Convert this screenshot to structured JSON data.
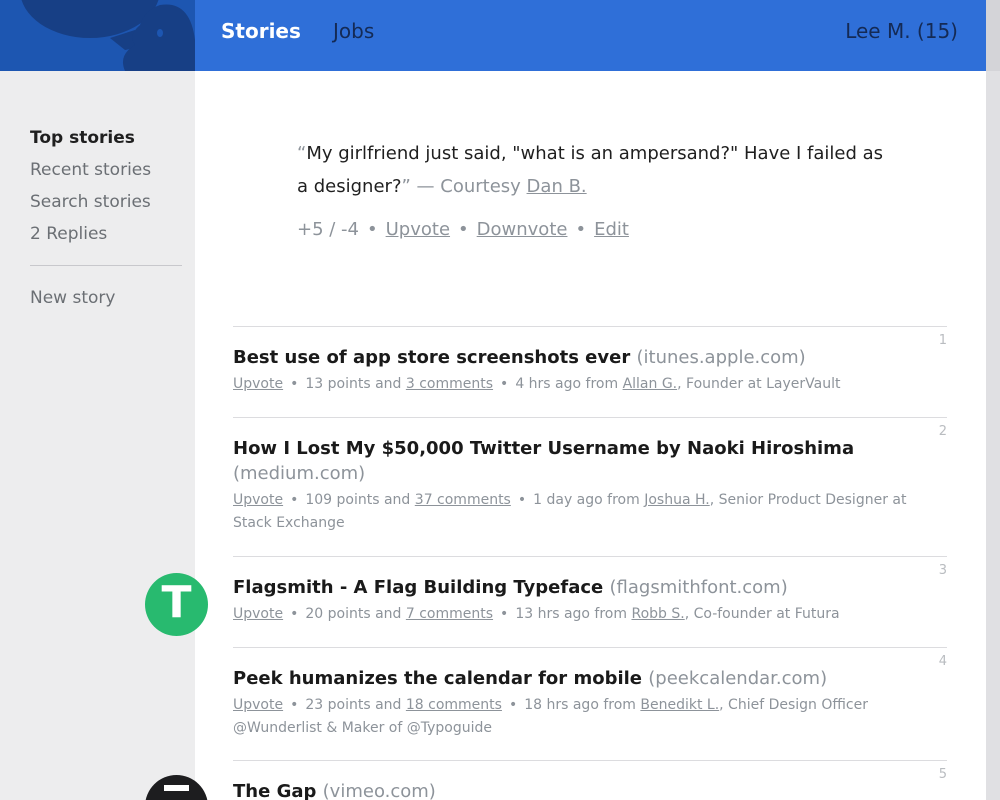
{
  "header": {
    "tabs": [
      "Stories",
      "Jobs"
    ],
    "user": "Lee M. (15)"
  },
  "sidebar": {
    "items": [
      "Top stories",
      "Recent stories",
      "Search stories",
      "2 Replies"
    ],
    "new_story": "New story"
  },
  "quote": {
    "text": "My girlfriend just said, \"what is an ampersand?\" Have I failed as a designer?",
    "open_mark": "“",
    "close_mark": "”",
    "credit_prefix": " — Courtesy ",
    "author": "Dan B.",
    "score": "+5 / -4",
    "upvote": "Upvote",
    "downvote": "Downvote",
    "edit": "Edit"
  },
  "stories": [
    {
      "rank": "1",
      "title": "Best use of app store screenshots ever",
      "domain": "(itunes.apple.com)",
      "upvote": "Upvote",
      "points": "13 points and",
      "comments": "3 comments",
      "time": "4 hrs ago from",
      "author": "Allan G.",
      "role": ", Founder at LayerVault"
    },
    {
      "rank": "2",
      "title": "How I Lost My $50,000 Twitter Username by Naoki Hiroshima",
      "domain": "(medium.com)",
      "upvote": "Upvote",
      "points": "109 points and",
      "comments": "37 comments",
      "time": "1 day ago from",
      "author": "Joshua H.",
      "role": ", Senior Product Designer at Stack Exchange"
    },
    {
      "rank": "3",
      "title": "Flagsmith - A Flag Building Typeface",
      "domain": "(flagsmithfont.com)",
      "upvote": "Upvote",
      "points": "20 points and",
      "comments": "7 comments",
      "time": "13 hrs ago from",
      "author": "Robb S.",
      "role": ", Co-founder at Futura"
    },
    {
      "rank": "4",
      "title": "Peek humanizes the calendar for mobile",
      "domain": "(peekcalendar.com)",
      "upvote": "Upvote",
      "points": "23 points and",
      "comments": "18 comments",
      "time": "18 hrs ago from",
      "author": "Benedikt L.",
      "role": ", Chief Design Officer @Wunderlist & Maker of @Typoguide"
    },
    {
      "rank": "5",
      "title": "The Gap",
      "domain": "(vimeo.com)"
    }
  ],
  "avatars": {
    "story3_letter": "T"
  },
  "colors": {
    "header_blue": "#2f6fd8",
    "logo_blue": "#1d56b1",
    "avatar_green": "#28ba6f"
  }
}
